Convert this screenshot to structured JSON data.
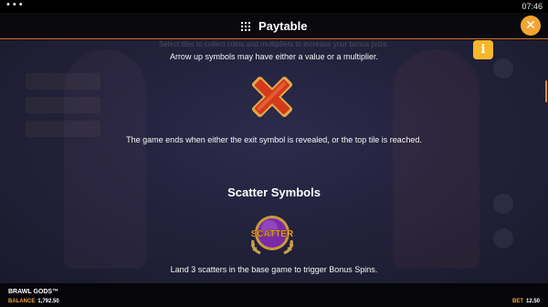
{
  "status_bar": {
    "menu_dots": "•••",
    "time": "07:46"
  },
  "header": {
    "title": "Paytable",
    "close_glyph": "✕"
  },
  "content": {
    "faded_text": "Select tiles to collect coins and multipliers to increase your bonus prize.",
    "line_arrow": "Arrow up symbols may have either a value or a multiplier.",
    "line_exit": "The game ends when either the exit symbol is revealed, or the top tile is reached.",
    "heading_scatter": "Scatter Symbols",
    "scatter_label": "SCATTER",
    "line_scatter": "Land 3 scatters in the base game to trigger Bonus Spins.",
    "info_glyph": "i"
  },
  "footer": {
    "game_name": "BRAWL GODS™",
    "balance_label": "BALANCE",
    "balance_value": "1,792.50",
    "bet_label": "BET",
    "bet_value": "12.50"
  },
  "colors": {
    "accent": "#f2a531",
    "divider": "#d6752a",
    "exit_red": "#d23a1c",
    "scatter_purple": "#7a2aa8"
  },
  "icons": [
    "grid-icon",
    "close-icon",
    "info-icon",
    "exit-symbol-icon",
    "scatter-symbol-icon"
  ]
}
